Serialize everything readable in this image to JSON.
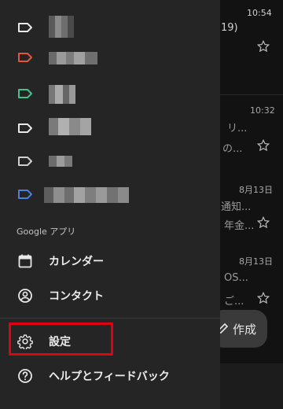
{
  "background": {
    "times": [
      "10:54",
      "10:32",
      "8月13日",
      "8月13日"
    ],
    "snippets": [
      "19)",
      "リ...",
      "の...",
      "通知...",
      "年金...",
      "OS...",
      "ご..."
    ],
    "fab_label": "作成"
  },
  "drawer": {
    "labels": [
      {
        "color": "#e8e8e8"
      },
      {
        "color": "#e8533f"
      },
      {
        "color": "#3ec48f"
      },
      {
        "color": "#e8e8e8"
      },
      {
        "color": "#cfcfcf"
      },
      {
        "color": "#4a7fe0"
      }
    ],
    "section_header": "Google アプリ",
    "apps": [
      {
        "label": "カレンダー",
        "icon": "calendar-icon"
      },
      {
        "label": "コンタクト",
        "icon": "contacts-icon"
      }
    ],
    "settings_label": "設定",
    "help_label": "ヘルプとフィードバック"
  },
  "colors": {
    "drawer_bg": "#252526",
    "highlight": "#e3000f"
  }
}
